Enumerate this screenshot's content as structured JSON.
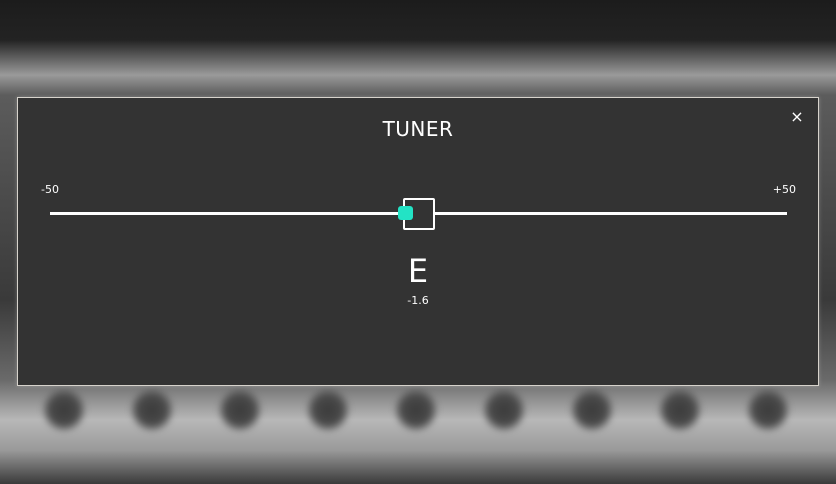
{
  "dialog": {
    "title": "TUNER",
    "close_label": "×"
  },
  "scale": {
    "min_label": "-50",
    "max_label": "+50",
    "min": -50,
    "max": 50
  },
  "reading": {
    "note": "E",
    "cents_label": "-1.6",
    "cents": -1.6
  },
  "colors": {
    "needle": "#23e3c5",
    "panel": "#333333",
    "track": "#ffffff"
  },
  "icons": {
    "close": "close-icon"
  }
}
